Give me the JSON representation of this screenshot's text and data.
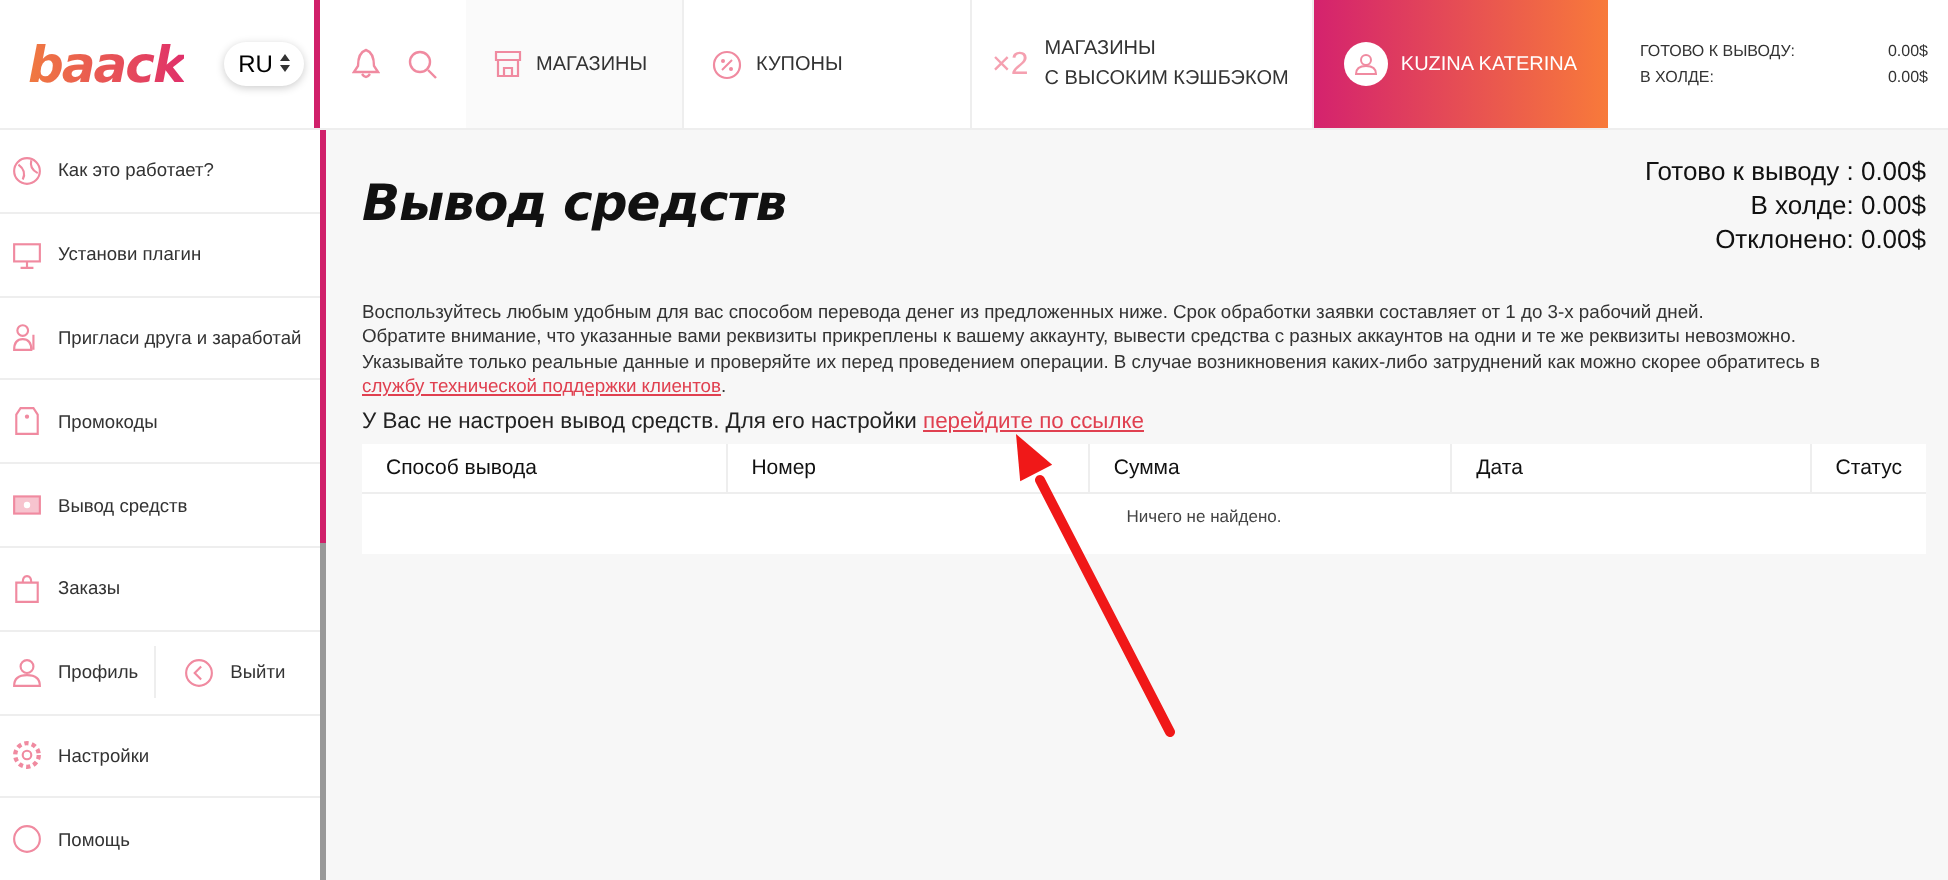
{
  "header": {
    "logo": "baack",
    "language": "RU",
    "nav": [
      {
        "label": "МАГАЗИНЫ"
      },
      {
        "label": "КУПОНЫ"
      }
    ],
    "promo": {
      "badge": "×2",
      "lines": [
        "МАГАЗИНЫ",
        "С ВЫСОКИМ КЭШБЭКОМ"
      ]
    },
    "user": "KUZINA KATERINA",
    "balance": [
      {
        "label": "ГОТОВО К ВЫВОДУ:",
        "value": "0.00$"
      },
      {
        "label": "В ХОЛДЕ:",
        "value": "0.00$"
      }
    ]
  },
  "sidebar": {
    "items": [
      {
        "kind": "item",
        "label": "Как это работает?"
      },
      {
        "kind": "item",
        "label": "Установи плагин"
      },
      {
        "kind": "item",
        "label": "Пригласи друга и заработай"
      },
      {
        "kind": "item",
        "label": "Промокоды"
      },
      {
        "kind": "item",
        "label": "Вывод средств"
      },
      {
        "kind": "item",
        "label": "Заказы"
      },
      {
        "kind": "split",
        "label": "Профиль",
        "second": "Выйти"
      },
      {
        "kind": "item",
        "label": "Настройки"
      },
      {
        "kind": "item",
        "label": "Помощь"
      }
    ]
  },
  "main": {
    "title": "Вывод средств",
    "totals": [
      {
        "label": "Готово к выводу :",
        "value": "0.00$"
      },
      {
        "label": "В холде:",
        "value": "0.00$"
      },
      {
        "label": "Отклонено:",
        "value": "0.00$"
      }
    ],
    "notes": [
      "Воспользуйтесь любым удобным для вас способом перевода денег из предложенных ниже. Срок обработки заявки составляет от 1 до 3-х рабочий дней.",
      "Обратите внимание, что указанные вами реквизиты прикреплены к вашему аккаунту, вывести средства с разных аккаунтов на одни и те же реквизиты невозможно.",
      "Указывайте только реальные данные и проверяйте их перед проведением операции. В случае возникновения каких-либо затруднений как можно скорее обратитесь в"
    ],
    "support_link": "службу технической поддержки клиентов",
    "support_end": ".",
    "setup_text": "У Вас не настроен вывод средств. Для его настройки",
    "setup_link": "перейдите по ссылке",
    "table": {
      "columns": [
        "Способ вывода",
        "Номер",
        "Сумма",
        "Дата",
        "Статус"
      ],
      "empty": "Ничего не найдено."
    }
  },
  "annotation": {
    "kind": "arrow"
  }
}
